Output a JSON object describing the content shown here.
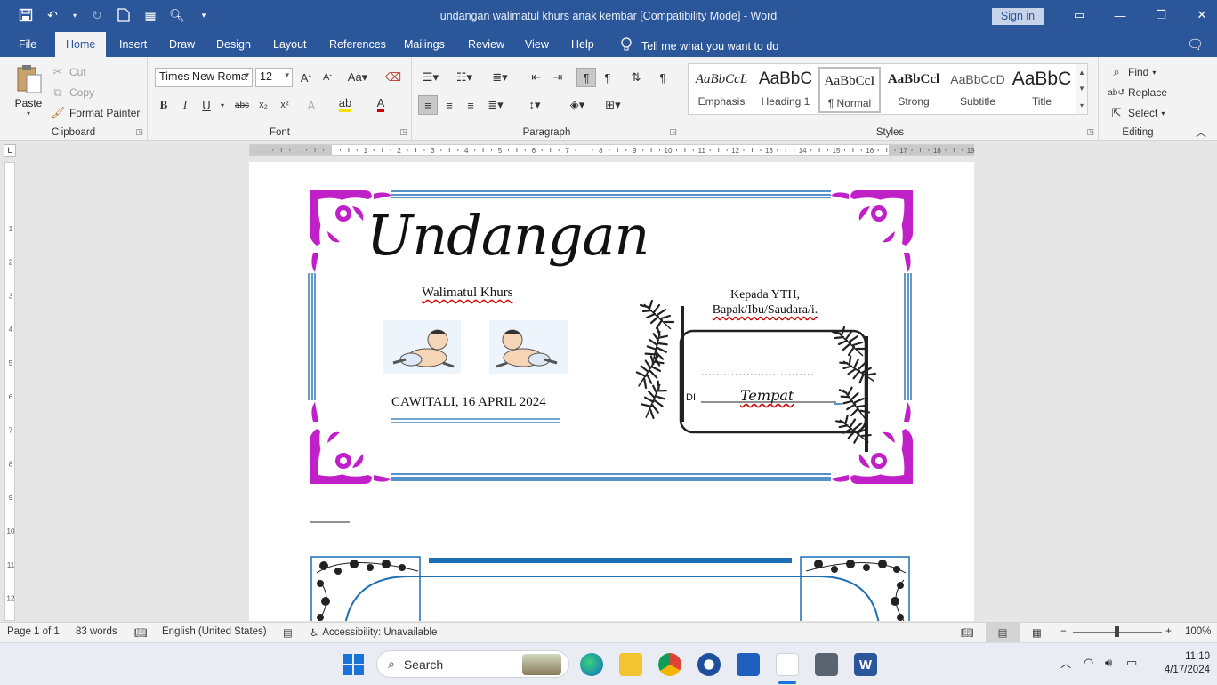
{
  "window": {
    "title": "undangan walimatul khurs anak kembar [Compatibility Mode]  -  Word",
    "sign_in": "Sign in"
  },
  "menu": {
    "tabs": [
      "File",
      "Home",
      "Insert",
      "Draw",
      "Design",
      "Layout",
      "References",
      "Mailings",
      "Review",
      "View",
      "Help"
    ],
    "active": "Home",
    "tell_me": "Tell me what you want to do"
  },
  "ribbon": {
    "clipboard": {
      "label": "Clipboard",
      "paste": "Paste",
      "cut": "Cut",
      "copy": "Copy",
      "format_painter": "Format Painter"
    },
    "font": {
      "label": "Font",
      "name": "Times New Roma",
      "size": "12"
    },
    "paragraph": {
      "label": "Paragraph"
    },
    "styles": {
      "label": "Styles",
      "items": [
        {
          "preview": "AaBbCcL",
          "name": "Emphasis"
        },
        {
          "preview": "AaBbC",
          "name": "Heading 1"
        },
        {
          "preview": "AaBbCcI",
          "name": "¶ Normal"
        },
        {
          "preview": "AaBbCcl",
          "name": "Strong"
        },
        {
          "preview": "AaBbCcD",
          "name": "Subtitle"
        },
        {
          "preview": "AaBbC",
          "name": "Title"
        }
      ]
    },
    "editing": {
      "label": "Editing",
      "find": "Find",
      "replace": "Replace",
      "select": "Select"
    }
  },
  "document": {
    "card1": {
      "heading": "Undangan",
      "subheading": "Walimatul Khurs",
      "date": "CAWITALI, 16 APRIL 2024",
      "to_line1": "Kepada YTH,",
      "to_line2": "Bapak/Ibu/Saudara/i.",
      "dots": "..............................",
      "di": "DI",
      "place": "Tempat"
    }
  },
  "statusbar": {
    "page": "Page 1 of 1",
    "words": "83 words",
    "language": "English (United States)",
    "accessibility": "Accessibility: Unavailable",
    "zoom": "100%"
  },
  "taskbar": {
    "search": "Search",
    "time": "11:10",
    "date": "4/17/2024"
  },
  "colors": {
    "word_blue": "#2b579a",
    "frame_magenta": "#c020c8",
    "frame_blue": "#1f6fb5"
  }
}
